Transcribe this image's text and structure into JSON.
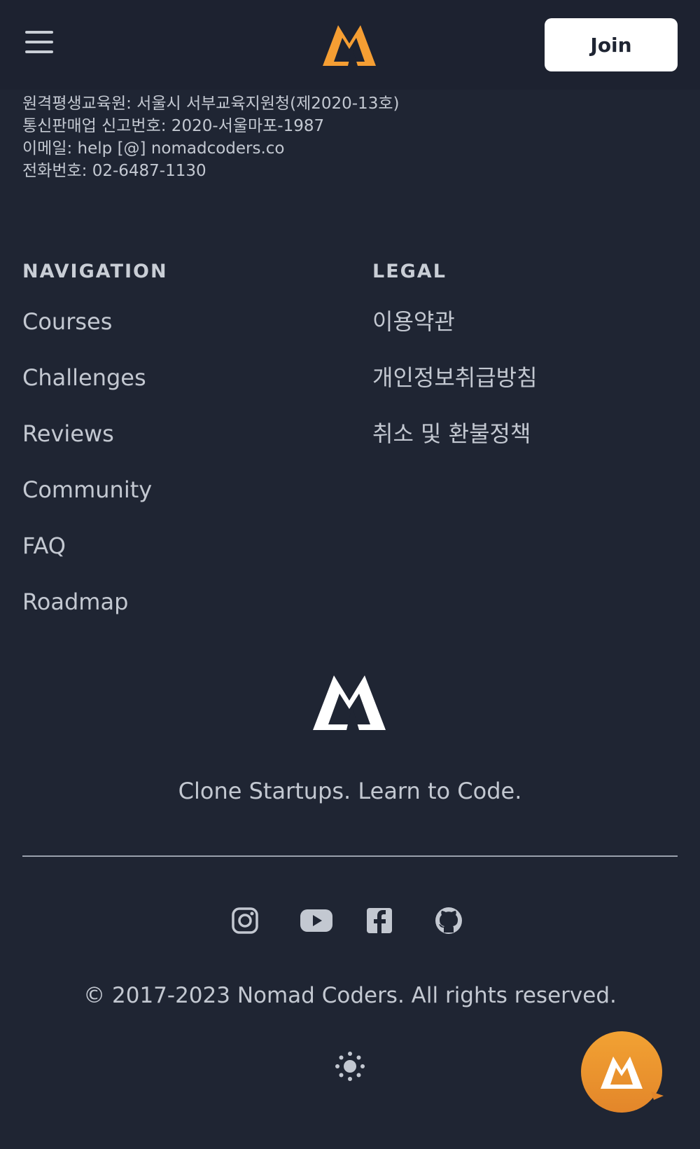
{
  "header": {
    "menu_icon": "hamburger-menu-icon",
    "logo_icon": "nomad-coders-logo",
    "join_label": "Join"
  },
  "company_info": [
    "원격평생교육원: 서울시 서부교육지원청(제2020-13호)",
    "통신판매업 신고번호: 2020-서울마포-1987",
    "이메일: help [@] nomadcoders.co",
    "전화번호: 02-6487-1130"
  ],
  "navigation": {
    "heading": "NAVIGATION",
    "items": [
      "Courses",
      "Challenges",
      "Reviews",
      "Community",
      "FAQ",
      "Roadmap"
    ]
  },
  "legal": {
    "heading": "LEGAL",
    "items": [
      "이용약관",
      "개인정보취급방침",
      "취소 및 환불정책"
    ]
  },
  "tagline": "Clone Startups. Learn to Code.",
  "social_icons": [
    "instagram-icon",
    "youtube-icon",
    "facebook-icon",
    "github-icon"
  ],
  "copyright": "© 2017-2023 Nomad Coders. All rights reserved.",
  "colors": {
    "background": "#1f2533",
    "accent": "#f59e33",
    "text": "#c3c8d1",
    "button": "#ffffff"
  }
}
